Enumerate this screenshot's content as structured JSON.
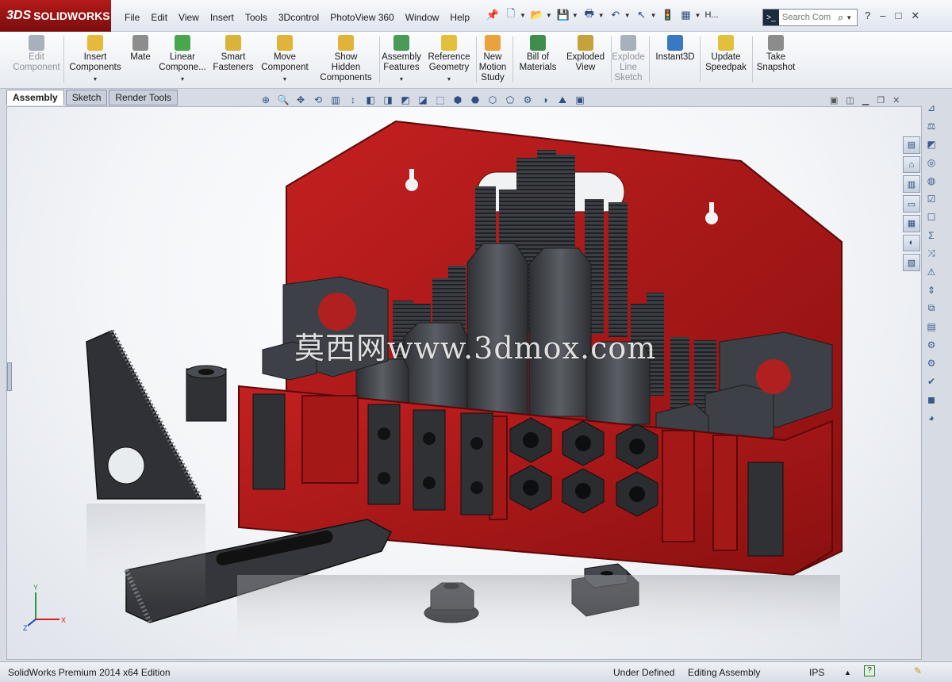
{
  "app": {
    "logo_prefix": "3DS",
    "logo_text": "SOLIDWORKS"
  },
  "menu": [
    "File",
    "Edit",
    "View",
    "Insert",
    "Tools",
    "3Dcontrol",
    "PhotoView 360",
    "Window",
    "Help"
  ],
  "quick_access_icons": [
    "pin-icon",
    "new-doc-icon",
    "open-icon",
    "save-icon",
    "print-icon",
    "undo-icon",
    "select-icon",
    "traffic-light-icon",
    "options-icon"
  ],
  "quick_access_more": "H...",
  "search": {
    "placeholder": "Search Com",
    "cmd_glyph": ">_"
  },
  "window_controls": [
    "?",
    "–",
    "□",
    "✕"
  ],
  "commands": [
    {
      "id": "edit-component",
      "label": "Edit\nComponent",
      "disabled": true,
      "color": "#a8b0bc"
    },
    {
      "id": "insert-components",
      "label": "Insert\nComponents",
      "dropdown": true,
      "color": "#e7b93a"
    },
    {
      "id": "mate",
      "label": "Mate",
      "color": "#8d8d8d"
    },
    {
      "id": "linear-component",
      "label": "Linear\nCompone...",
      "dropdown": true,
      "color": "#48a64c"
    },
    {
      "id": "smart-fasteners",
      "label": "Smart\nFasteners",
      "color": "#d8b43a"
    },
    {
      "id": "move-component",
      "label": "Move\nComponent",
      "dropdown": true,
      "color": "#e0b43a"
    },
    {
      "id": "show-hidden",
      "label": "Show\nHidden\nComponents",
      "color": "#e0b43a"
    },
    {
      "id": "assembly-features",
      "label": "Assembly\nFeatures",
      "dropdown": true,
      "color": "#4a9b5a"
    },
    {
      "id": "reference-geometry",
      "label": "Reference\nGeometry",
      "dropdown": true,
      "color": "#e2c03c"
    },
    {
      "id": "new-motion-study",
      "label": "New\nMotion\nStudy",
      "color": "#e9a23c"
    },
    {
      "id": "bill-of-materials",
      "label": "Bill of\nMaterials",
      "color": "#3f8f4c"
    },
    {
      "id": "exploded-view",
      "label": "Exploded\nView",
      "color": "#c6a33a"
    },
    {
      "id": "explode-line-sketch",
      "label": "Explode\nLine\nSketch",
      "disabled": true,
      "color": "#a8b0bc"
    },
    {
      "id": "instant3d",
      "label": "Instant3D",
      "color": "#3a78c4"
    },
    {
      "id": "update-speedpak",
      "label": "Update\nSpeedpak",
      "color": "#e2c03c"
    },
    {
      "id": "take-snapshot",
      "label": "Take\nSnapshot",
      "color": "#8c8c8c"
    }
  ],
  "tabs": [
    "Assembly",
    "Sketch",
    "Render Tools"
  ],
  "active_tab": "Assembly",
  "viewport": {
    "watermark": "莫西网www.3dmox.com",
    "triad": {
      "x": "X",
      "y": "Y",
      "z": "Z"
    }
  },
  "status": {
    "edition": "SolidWorks Premium 2014 x64 Edition",
    "state": "Under Defined",
    "mode": "Editing Assembly",
    "units": "IPS"
  },
  "colors": {
    "holder_red": "#b01a1a",
    "holder_dark": "#6e0c0c",
    "steel": "#3b3e43",
    "steel_light": "#5c6068",
    "accent": "#2f4f84"
  }
}
